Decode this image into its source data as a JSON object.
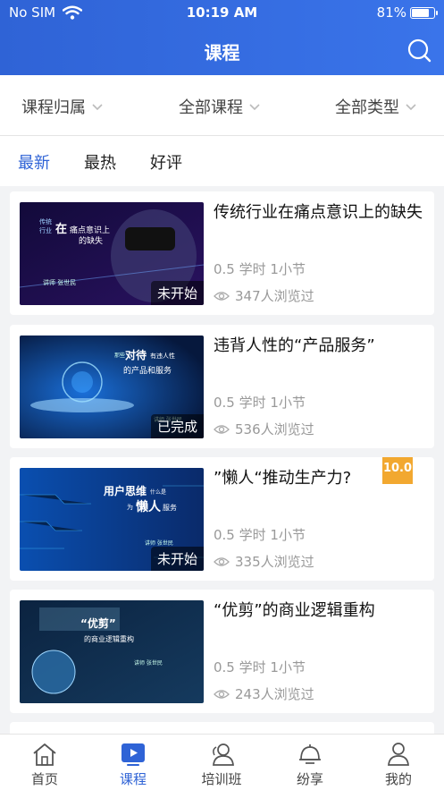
{
  "status_bar": {
    "carrier": "No SIM",
    "time": "10:19 AM",
    "battery": "81%",
    "battery_level": 0.81
  },
  "nav": {
    "title": "课程",
    "search_icon": "search-icon"
  },
  "filters": [
    {
      "label": "课程归属"
    },
    {
      "label": "全部课程"
    },
    {
      "label": "全部类型"
    }
  ],
  "sort_tabs": [
    {
      "label": "最新",
      "active": true
    },
    {
      "label": "最热",
      "active": false
    },
    {
      "label": "好评",
      "active": false
    }
  ],
  "courses": [
    {
      "title": "传统行业在痛点意识上的缺失",
      "status": "未开始",
      "hours": "0.5 学时",
      "sections": "1小节",
      "views": "347人浏览过",
      "thumb_text": "传统行业在痛点意识上的缺失",
      "thumb_speaker": "讲师 张世民"
    },
    {
      "title": "违背人性的“产品服务”",
      "status": "已完成",
      "hours": "0.5 学时",
      "sections": "1小节",
      "views": "536人浏览过",
      "thumb_text": "那些对待有违人性的产品和服务",
      "thumb_speaker": "讲师 张世民"
    },
    {
      "title": "”懒人“推动生产力?",
      "status": "未开始",
      "hours": "0.5 学时",
      "sections": "1小节",
      "views": "335人浏览过",
      "score": "10.0",
      "thumb_text": "用户思维什么是为懒人服务",
      "thumb_speaker": "讲师 张世民"
    },
    {
      "title": "“优剪”的商业逻辑重构",
      "status": "",
      "hours": "0.5 学时",
      "sections": "1小节",
      "views": "243人浏览过",
      "thumb_text": "“优剪”的商业逻辑重构",
      "thumb_speaker": "讲师 张世民"
    }
  ],
  "tab_bar": [
    {
      "label": "首页",
      "icon": "home-icon",
      "active": false
    },
    {
      "label": "课程",
      "icon": "play-icon",
      "active": true
    },
    {
      "label": "培训班",
      "icon": "group-icon",
      "active": false
    },
    {
      "label": "纷享",
      "icon": "share-icon",
      "active": false
    },
    {
      "label": "我的",
      "icon": "user-icon",
      "active": false
    }
  ],
  "colors": {
    "accent": "#2f63d6",
    "badge": "#f2a830"
  }
}
